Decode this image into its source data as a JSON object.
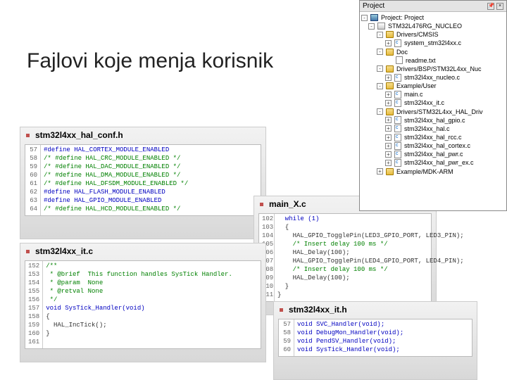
{
  "title": "Fajlovi koje menja korisnik",
  "panels": {
    "p1": {
      "label": "stm32l4xx_hal_conf.h",
      "lines": [
        {
          "n": "57",
          "t": "#define HAL_CORTEX_MODULE_ENABLED",
          "cls": "kw"
        },
        {
          "n": "58",
          "t": "/* #define HAL_CRC_MODULE_ENABLED */",
          "cls": "cm"
        },
        {
          "n": "59",
          "t": "/* #define HAL_DAC_MODULE_ENABLED */",
          "cls": "cm"
        },
        {
          "n": "60",
          "t": "/* #define HAL_DMA_MODULE_ENABLED */",
          "cls": "cm"
        },
        {
          "n": "61",
          "t": "/* #define HAL_DFSDM_MODULE_ENABLED */",
          "cls": "cm"
        },
        {
          "n": "62",
          "t": "#define HAL_FLASH_MODULE_ENABLED",
          "cls": "kw"
        },
        {
          "n": "63",
          "t": "#define HAL_GPIO_MODULE_ENABLED",
          "cls": "kw"
        },
        {
          "n": "64",
          "t": "/* #define HAL_HCD_MODULE_ENABLED */",
          "cls": "cm"
        }
      ]
    },
    "p2": {
      "label": "stm32l4xx_it.c",
      "lines": [
        {
          "n": "152",
          "t": "/**",
          "cls": "cm"
        },
        {
          "n": "153",
          "t": " * @brief  This function handles SysTick Handler.",
          "cls": "cm"
        },
        {
          "n": "154",
          "t": " * @param  None",
          "cls": "cm"
        },
        {
          "n": "155",
          "t": " * @retval None",
          "cls": "cm"
        },
        {
          "n": "156",
          "t": " */",
          "cls": "cm"
        },
        {
          "n": "157",
          "t": "void SysTick_Handler(void)",
          "cls": "kw"
        },
        {
          "n": "158",
          "t": "{",
          "cls": ""
        },
        {
          "n": "159",
          "t": "  HAL_IncTick();",
          "cls": ""
        },
        {
          "n": "160",
          "t": "}",
          "cls": ""
        },
        {
          "n": "161",
          "t": "",
          "cls": ""
        }
      ]
    },
    "p3": {
      "label": "main_X.c",
      "lines": [
        {
          "n": "102",
          "t": "  while (1)",
          "cls": "kw"
        },
        {
          "n": "103",
          "t": "  {",
          "cls": ""
        },
        {
          "n": "104",
          "t": "    HAL_GPIO_TogglePin(LED3_GPIO_PORT, LED3_PIN);",
          "cls": ""
        },
        {
          "n": "105",
          "t": "    /* Insert delay 100 ms */",
          "cls": "cm"
        },
        {
          "n": "106",
          "t": "    HAL_Delay(100);",
          "cls": ""
        },
        {
          "n": "107",
          "t": "    HAL_GPIO_TogglePin(LED4_GPIO_PORT, LED4_PIN);",
          "cls": ""
        },
        {
          "n": "108",
          "t": "    /* Insert delay 100 ms */",
          "cls": "cm"
        },
        {
          "n": "109",
          "t": "    HAL_Delay(100);",
          "cls": ""
        },
        {
          "n": "110",
          "t": "  }",
          "cls": ""
        },
        {
          "n": "111",
          "t": "}",
          "cls": ""
        }
      ]
    },
    "p4": {
      "label": "stm32l4xx_it.h",
      "lines": [
        {
          "n": "57",
          "t": "void SVC_Handler(void);",
          "cls": "kw"
        },
        {
          "n": "58",
          "t": "void DebugMon_Handler(void);",
          "cls": "kw"
        },
        {
          "n": "59",
          "t": "void PendSV_Handler(void);",
          "cls": "kw"
        },
        {
          "n": "60",
          "t": "void SysTick_Handler(void);",
          "cls": "kw"
        }
      ]
    }
  },
  "tree": {
    "title": "Project",
    "items": [
      {
        "ind": 0,
        "pm": "-",
        "ic": "proj",
        "label": "Project: Project"
      },
      {
        "ind": 1,
        "pm": "-",
        "ic": "target",
        "label": "STM32L476RG_NUCLEO"
      },
      {
        "ind": 2,
        "pm": "-",
        "ic": "folder",
        "label": "Drivers/CMSIS"
      },
      {
        "ind": 3,
        "pm": "+",
        "ic": "cfile",
        "label": "system_stm32l4xx.c"
      },
      {
        "ind": 2,
        "pm": "-",
        "ic": "folder",
        "label": "Doc"
      },
      {
        "ind": 3,
        "pm": "",
        "ic": "txt",
        "label": "readme.txt"
      },
      {
        "ind": 2,
        "pm": "-",
        "ic": "folder",
        "label": "Drivers/BSP/STM32L4xx_Nuc"
      },
      {
        "ind": 3,
        "pm": "+",
        "ic": "cfile",
        "label": "stm32l4xx_nucleo.c"
      },
      {
        "ind": 2,
        "pm": "-",
        "ic": "folder",
        "label": "Example/User"
      },
      {
        "ind": 3,
        "pm": "+",
        "ic": "cfile",
        "label": "main.c"
      },
      {
        "ind": 3,
        "pm": "+",
        "ic": "cfile",
        "label": "stm32l4xx_it.c"
      },
      {
        "ind": 2,
        "pm": "-",
        "ic": "folder",
        "label": "Drivers/STM32L4xx_HAL_Driv"
      },
      {
        "ind": 3,
        "pm": "+",
        "ic": "cfile",
        "label": "stm32l4xx_hal_gpio.c"
      },
      {
        "ind": 3,
        "pm": "+",
        "ic": "cfile",
        "label": "stm32l4xx_hal.c"
      },
      {
        "ind": 3,
        "pm": "+",
        "ic": "cfile",
        "label": "stm32l4xx_hal_rcc.c"
      },
      {
        "ind": 3,
        "pm": "+",
        "ic": "cfile",
        "label": "stm32l4xx_hal_cortex.c"
      },
      {
        "ind": 3,
        "pm": "+",
        "ic": "cfile",
        "label": "stm32l4xx_hal_pwr.c"
      },
      {
        "ind": 3,
        "pm": "+",
        "ic": "cfile",
        "label": "stm32l4xx_hal_pwr_ex.c"
      },
      {
        "ind": 2,
        "pm": "+",
        "ic": "folder",
        "label": "Example/MDK-ARM"
      }
    ]
  }
}
